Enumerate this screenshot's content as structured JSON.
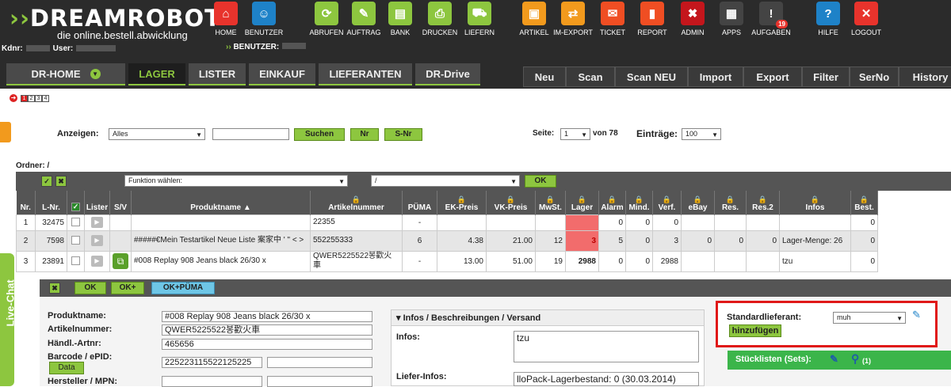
{
  "brand": {
    "logo_part1": "DREAM",
    "logo_part2": "ROBOT",
    "tagline": "die online.bestell.abwicklung",
    "kdnr_label": "Kdnr:",
    "user_label": "User:",
    "benutzer_label": "BENUTZER:"
  },
  "topnav": [
    {
      "label": "HOME",
      "icon": "home-icon",
      "color": "#e8332c",
      "glyph": "⌂"
    },
    {
      "label": "BENUTZER",
      "icon": "user-icon",
      "color": "#1e82c8",
      "glyph": "☺"
    },
    {
      "label": "ABRUFEN",
      "icon": "download-icon",
      "color": "#8dc63f",
      "glyph": "⟳"
    },
    {
      "label": "AUFTRAG",
      "icon": "order-icon",
      "color": "#8dc63f",
      "glyph": "✎"
    },
    {
      "label": "BANK",
      "icon": "bank-icon",
      "color": "#8dc63f",
      "glyph": "▤"
    },
    {
      "label": "DRUCKEN",
      "icon": "printer-icon",
      "color": "#8dc63f",
      "glyph": "⎙"
    },
    {
      "label": "LIEFERN",
      "icon": "cart-icon",
      "color": "#8dc63f",
      "glyph": "⛟"
    },
    {
      "label": "ARTIKEL",
      "icon": "box-icon",
      "color": "#f29a1d",
      "glyph": "▣"
    },
    {
      "label": "IM-EXPORT",
      "icon": "import-export-icon",
      "color": "#f29a1d",
      "glyph": "⇄"
    },
    {
      "label": "TICKET",
      "icon": "mail-icon",
      "color": "#f04e23",
      "glyph": "✉"
    },
    {
      "label": "REPORT",
      "icon": "chart-icon",
      "color": "#f04e23",
      "glyph": "▮"
    },
    {
      "label": "ADMIN",
      "icon": "admin-icon",
      "color": "#c4161c",
      "glyph": "✖"
    },
    {
      "label": "APPS",
      "icon": "apps-icon",
      "color": "#444",
      "glyph": "▦"
    },
    {
      "label": "AUFGABEN",
      "icon": "tasks-icon",
      "color": "#444",
      "glyph": "!",
      "badge": "19"
    },
    {
      "label": "HILFE",
      "icon": "help-icon",
      "color": "#1e82c8",
      "glyph": "?"
    },
    {
      "label": "LOGOUT",
      "icon": "logout-icon",
      "color": "#e8332c",
      "glyph": "✕"
    }
  ],
  "maintabs": [
    "DR-HOME",
    "LAGER",
    "LISTER",
    "EINKAUF",
    "LIEFERANTEN",
    "DR-Drive"
  ],
  "subtabs": [
    "Neu",
    "Scan",
    "Scan NEU",
    "Import",
    "Export",
    "Filter",
    "SerNo",
    "History"
  ],
  "steps": [
    "1",
    "2",
    "3",
    "4"
  ],
  "filter": {
    "anzeigen_label": "Anzeigen:",
    "anzeigen_value": "Alles",
    "search_value": "",
    "suchen": "Suchen",
    "nr": "Nr",
    "snr": "S-Nr",
    "seite_label": "Seite:",
    "seite_value": "1",
    "von": "von 78",
    "eintraege_label": "Einträge:",
    "eintraege_value": "100"
  },
  "ordner": "Ordner: /",
  "toolbar": {
    "funktion": "Funktion wählen:",
    "folder": "/",
    "ok": "OK"
  },
  "columns": [
    "Nr.",
    "L-Nr.",
    "",
    "Lister",
    "S/V",
    "Produktname ▲",
    "Artikelnummer",
    "PÜMA",
    "EK-Preis",
    "VK-Preis",
    "MwSt.",
    "Lager",
    "Alarm",
    "Mind.",
    "Verf.",
    "eBay",
    "Res.",
    "Res.2",
    "Infos",
    "Best."
  ],
  "locked": [
    false,
    false,
    false,
    false,
    false,
    false,
    true,
    false,
    true,
    true,
    true,
    true,
    true,
    true,
    true,
    true,
    true,
    true,
    true,
    true
  ],
  "rows": [
    {
      "nr": "1",
      "lnr": "32475",
      "name": "",
      "artnr": "22355",
      "puema": "-",
      "ek": "",
      "vk": "",
      "mwst": "",
      "lager": "",
      "alarm": "0",
      "mind": "0",
      "verf": "0",
      "ebay": "",
      "res": "",
      "res2": "",
      "infos": "",
      "best": "0"
    },
    {
      "nr": "2",
      "lnr": "7598",
      "name": "#####€Mein Testartikel Neue Liste 案家中 ' \" < >",
      "artnr": "552255333",
      "puema": "6",
      "ek": "4.38",
      "vk": "21.00",
      "mwst": "12",
      "lager": "3",
      "alarm": "5",
      "mind": "0",
      "verf": "3",
      "ebay": "0",
      "res": "0",
      "res2": "0",
      "infos": "Lager-Menge: 26",
      "best": "0"
    },
    {
      "nr": "3",
      "lnr": "23891",
      "name": "#008 Replay 908 Jeans black 26/30 x",
      "artnr": "QWER5225522봉歡火車",
      "puema": "-",
      "ek": "13.00",
      "vk": "51.00",
      "mwst": "19",
      "lager": "2988",
      "alarm": "0",
      "mind": "0",
      "verf": "2988",
      "ebay": "",
      "res": "",
      "res2": "",
      "infos": "tzu",
      "best": "0"
    }
  ],
  "subbar": {
    "ok": "OK",
    "okplus": "OK+",
    "okpuema": "OK+PÜMA"
  },
  "detail": {
    "produktname_label": "Produktname:",
    "produktname": "#008 Replay 908 Jeans black 26/30 x",
    "artikelnummer_label": "Artikelnummer:",
    "artikelnummer": "QWER5225522봉歡火車",
    "haendl_label": "Händl.-Artnr:",
    "haendl": "465656",
    "barcode_label": "Barcode / ePID:",
    "barcode": "225223115522125225",
    "data_btn": "Data",
    "hersteller_label": "Hersteller / MPN:"
  },
  "infobox": {
    "header": "Infos / Beschreibungen / Versand",
    "infos_label": "Infos:",
    "infos_value": "tzu",
    "liefer_label": "Liefer-Infos:",
    "liefer_value": "lloPack-Lagerbestand: 0  (30.03.2014)"
  },
  "standard": {
    "label": "Standardlieferant:",
    "value": "muh",
    "add": "hinzufügen"
  },
  "stueck": {
    "label": "Stücklisten (Sets):",
    "count": "(1)"
  },
  "livechat": "Live-Chat"
}
